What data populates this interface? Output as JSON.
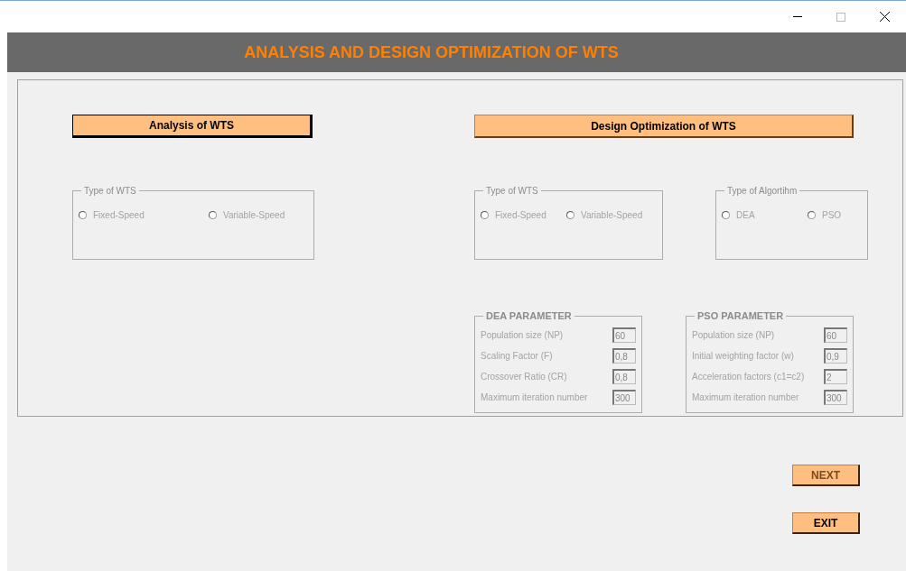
{
  "header": {
    "title": "ANALYSIS AND DESIGN OPTIMIZATION OF WTS"
  },
  "analysis": {
    "button": {
      "label": "Analysis of WTS",
      "selected": true
    },
    "groups": [
      {
        "title": "Type of WTS",
        "options": [
          {
            "label": "Fixed-Speed",
            "selected": false
          },
          {
            "label": "Variable-Speed",
            "selected": false
          }
        ]
      }
    ]
  },
  "design": {
    "button": {
      "label": "Design Optimization of WTS",
      "selected": false
    },
    "groups": [
      {
        "title": "Type of WTS",
        "options": [
          {
            "label": "Fixed-Speed",
            "selected": false
          },
          {
            "label": "Variable-Speed",
            "selected": false
          }
        ]
      },
      {
        "title": "Type of Algortihm",
        "options": [
          {
            "label": "DEA",
            "selected": false
          },
          {
            "label": "PSO",
            "selected": false
          }
        ]
      }
    ],
    "parameters": [
      {
        "title": "DEA PARAMETER",
        "fields": [
          {
            "label": "Population size (NP)",
            "value": "60"
          },
          {
            "label": "Scaling Factor (F)",
            "value": "0,8"
          },
          {
            "label": "Crossover Ratio (CR)",
            "value": "0,8"
          },
          {
            "label": "Maximum iteration number",
            "value": "300"
          }
        ]
      },
      {
        "title": "PSO PARAMETER",
        "fields": [
          {
            "label": "Population size (NP)",
            "value": "60"
          },
          {
            "label": "Initial weighting factor (w)",
            "value": "0,9"
          },
          {
            "label": "Acceleration factors (c1=c2)",
            "value": "2"
          },
          {
            "label": "Maximum iteration number",
            "value": "300"
          }
        ]
      }
    ]
  },
  "buttons": [
    {
      "label": "NEXT",
      "disabled": true
    },
    {
      "label": "EXIT",
      "disabled": false
    }
  ]
}
